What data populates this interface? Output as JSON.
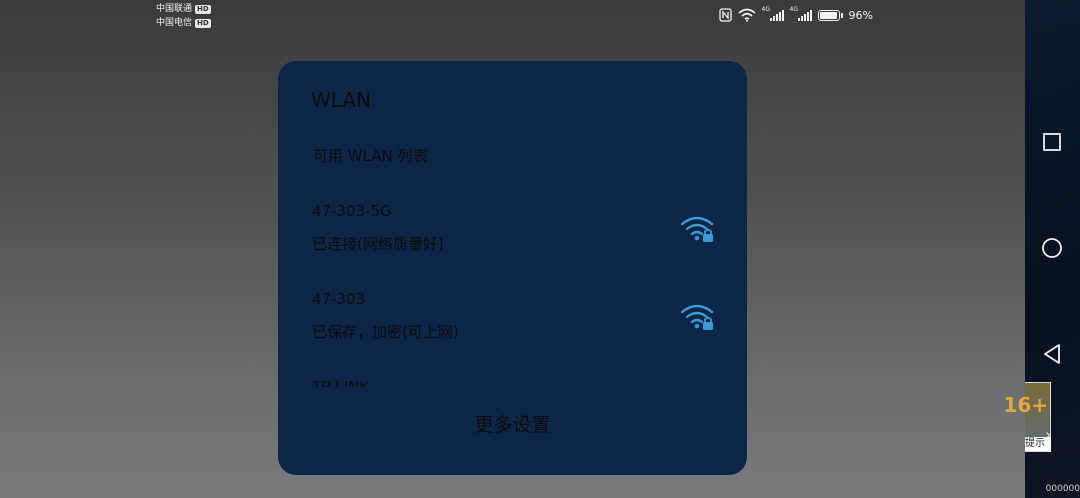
{
  "status_bar": {
    "carrier1": "中国联通",
    "carrier2": "中国电信",
    "hd_label": "HD",
    "signal_tag1": "4G",
    "signal_tag2": "4G",
    "battery_percent": "96%",
    "battery_level": 0.96,
    "icons": [
      "nfc-icon",
      "wifi-icon",
      "signal-icon",
      "signal-icon",
      "battery-icon"
    ]
  },
  "wlan_panel": {
    "title": "WLAN",
    "section_label": "可用 WLAN 列表",
    "networks": [
      {
        "name": "47-303-5G",
        "status": "已连接(网络质量好)",
        "icon": "wifi-lock-icon"
      },
      {
        "name": "47-303",
        "status": "已保存，加密(可上网)",
        "icon": "wifi-lock-icon"
      }
    ],
    "partial_network": "TP-LINK",
    "more_settings": "更多设置"
  },
  "nav": {
    "buttons": [
      "recent-apps-icon",
      "home-icon",
      "back-icon"
    ],
    "age_rating": "16+",
    "age_hint": "提示",
    "bottom_digits": "000000"
  },
  "colors": {
    "panel_bg": "#0d2648",
    "wifi_icon": "#3c9bd4",
    "panel_text": "#0c0c0c"
  }
}
